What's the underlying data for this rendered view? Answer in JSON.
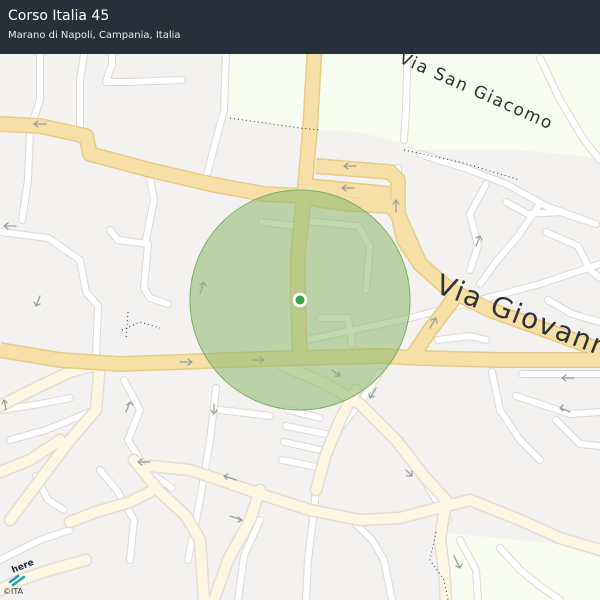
{
  "header": {
    "title": "Corso Italia 45",
    "subtitle": "Marano di Napoli, Campania, Italia"
  },
  "streets": {
    "via_san_giacomo": "Via San Giacomo",
    "via_giovanni": "Via Giovann"
  },
  "marker": {
    "accuracy_color": "#9dc481",
    "pin_color": "#3aa446"
  },
  "colors": {
    "background": "#f3f2f1",
    "header_background": "#25303b",
    "main_road": "#f5dfa4",
    "minor_road": "#ffffff",
    "park_area": "#f8fbef"
  },
  "branding": {
    "logo_text": "here",
    "copyright": "©ITA"
  }
}
